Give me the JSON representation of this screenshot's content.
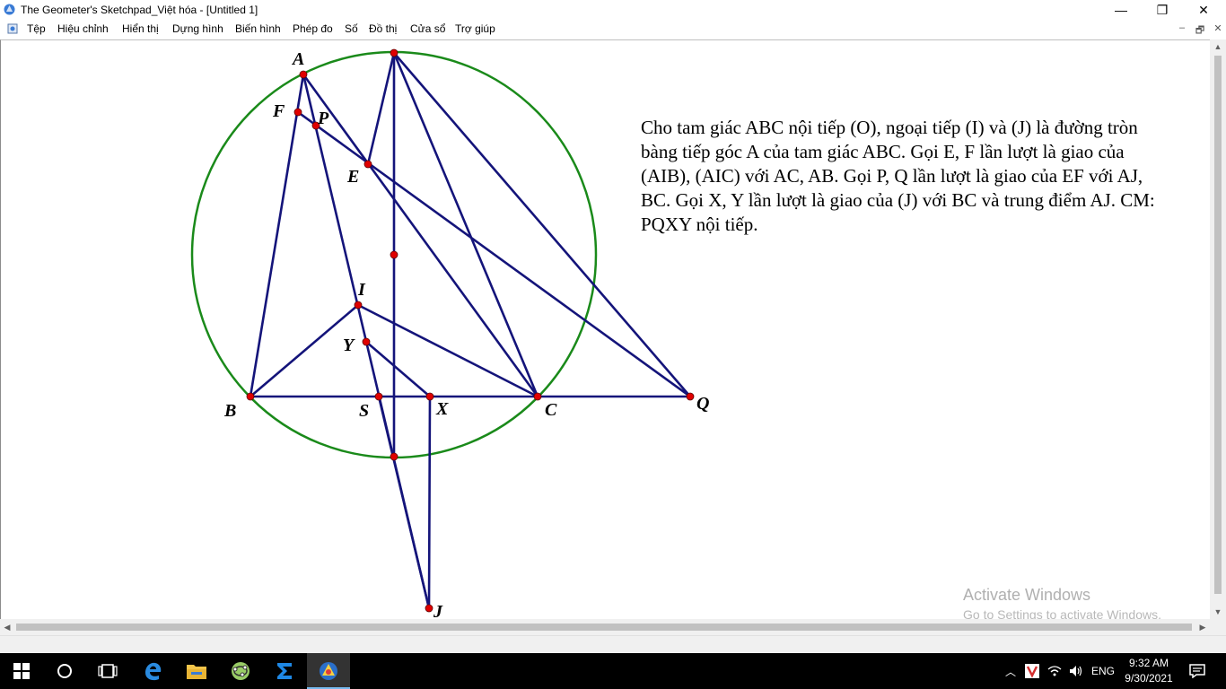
{
  "window": {
    "title": "The Geometer's Sketchpad_Việt hóa - [Untitled 1]",
    "minimize": "—",
    "restore": "❐",
    "close": "✕"
  },
  "menu": {
    "items": [
      "Tệp",
      "Hiệu chỉnh",
      "Hiển thị",
      "Dựng hình",
      "Biến hình",
      "Phép đo",
      "Số",
      "Đồ thị",
      "Cửa sổ",
      "Trợ giúp"
    ],
    "doc_minimize": "–",
    "doc_restore": "🗗",
    "doc_close": "✕"
  },
  "sketch": {
    "problem_text": "Cho tam giác ABC nội tiếp (O), ngoại tiếp (I) và (J) là đường tròn bàng tiếp góc A của tam giác ABC. Gọi E, F lần lượt là giao của (AIB), (AIC) với AC, AB. Gọi P, Q lần lượt là giao của EF với AJ, BC. Gọi X, Y lần lượt là giao của (J) với BC và trung điểm AJ. CM: PQXY nội tiếp.",
    "labels": {
      "A": "A",
      "F": "F",
      "P": "P",
      "E": "E",
      "I": "I",
      "Y": "Y",
      "B": "B",
      "S": "S",
      "X": "X",
      "C": "C",
      "Q": "Q",
      "J": "J"
    },
    "colors": {
      "circle": "#1a8a1a",
      "segment": "#14147a",
      "point": "#e00000"
    }
  },
  "watermark": {
    "line1": "Activate Windows",
    "line2": "Go to Settings to activate Windows."
  },
  "taskbar": {
    "apps": [
      "windows-start",
      "cortana-search",
      "task-view",
      "edge",
      "file-explorer",
      "geogebra",
      "sigma-app",
      "sketchpad"
    ],
    "tray_language": "ENG",
    "time": "9:32 AM",
    "date": "9/30/2021"
  }
}
